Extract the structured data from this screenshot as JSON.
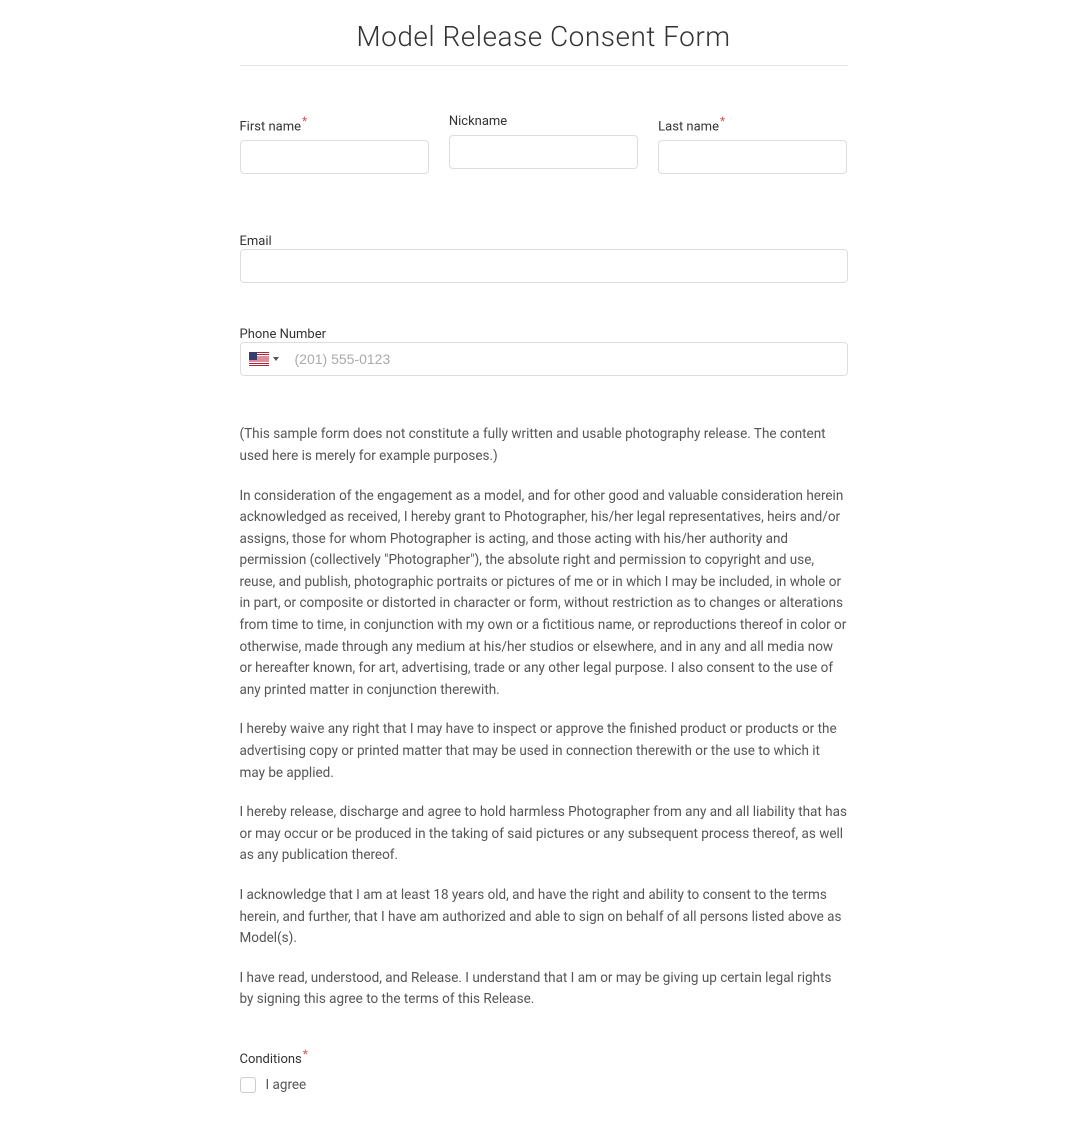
{
  "title": "Model Release Consent Form",
  "fields": {
    "first_name": {
      "label": "First name",
      "required": true,
      "value": ""
    },
    "nickname": {
      "label": "Nickname",
      "required": false,
      "value": ""
    },
    "last_name": {
      "label": "Last name",
      "required": true,
      "value": ""
    },
    "email": {
      "label": "Email",
      "required": false,
      "value": ""
    },
    "phone": {
      "label": "Phone Number",
      "required": false,
      "placeholder": "(201) 555-0123",
      "value": "",
      "country_flag": "us"
    },
    "conditions": {
      "label": "Conditions",
      "required": true,
      "checkbox_label": "I agree",
      "checked": false
    }
  },
  "required_marker": "*",
  "body_paragraphs": [
    "(This sample form does not constitute a fully written and usable photography release. The content used here is merely for example purposes.)",
    "In consideration of the engagement as a model, and for other good and valuable consideration herein acknowledged as received, I hereby grant to Photographer, his/her legal representatives, heirs and/or assigns, those for whom Photographer is acting, and those acting with his/her authority and permission (collectively \"Photographer\"), the absolute right and permission to copyright and use, reuse, and publish, photographic portraits or pictures of me or in which I may be included, in whole or in part, or composite or distorted in character or form, without restriction as to changes or alterations from time to time, in conjunction with my own or a fictitious name, or reproductions thereof in color or otherwise, made through any medium at his/her studios or elsewhere, and in any and all media now or hereafter known, for art, advertising, trade or any other legal purpose. I also consent to the use of any printed matter in conjunction therewith.",
    "I hereby waive any right that I may have to inspect or approve the finished product or products or the advertising copy or printed matter that may be used in connection therewith or the use to which it may be applied.",
    "I hereby release, discharge and agree to hold harmless Photographer from any and all liability that has or may occur or be produced in the taking of said pictures or any subsequent process thereof, as well as any publication thereof.",
    "I acknowledge that I am at least 18 years old, and have the right and ability to consent to the terms herein, and further, that I have am authorized and able to sign on behalf of all persons listed above as Model(s).",
    "I have read, understood, and Release. I understand that I am or may be giving up certain legal rights by signing this agree to the terms of this Release."
  ]
}
